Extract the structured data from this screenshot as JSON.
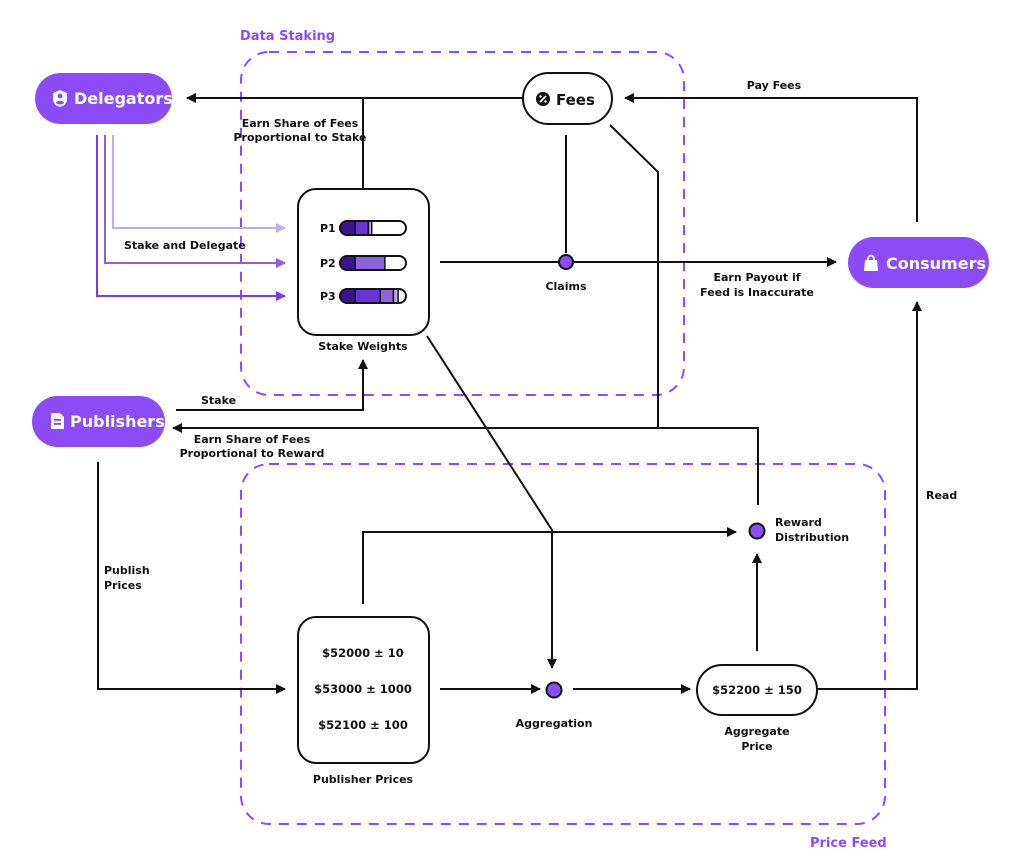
{
  "colors": {
    "accent": "#8b4cf7",
    "line": "#111111",
    "bar_dark": "#3b1491",
    "bar_mid": "#6a34d9",
    "bar_light": "#8d63e0",
    "bar_pale": "#c0a9f0",
    "delegate_pale": "#c2abf1",
    "delegate_mid": "#8b5ee6",
    "delegate_dark": "#7a3bf0"
  },
  "regions": {
    "data_staking": "Data Staking",
    "price_feed": "Price Feed"
  },
  "actors": {
    "delegators": {
      "label": "Delegators",
      "icon": "shield-user-icon"
    },
    "publishers": {
      "label": "Publishers",
      "icon": "document-icon"
    },
    "consumers": {
      "label": "Consumers",
      "icon": "shopping-bag-icon"
    }
  },
  "fees": {
    "label": "Fees",
    "icon": "percent-badge-icon"
  },
  "stake_weights": {
    "label": "Stake Weights",
    "publishers": [
      {
        "name": "P1",
        "segments": [
          {
            "share": 0.23,
            "color": "bar_dark"
          },
          {
            "share": 0.2,
            "color": "bar_mid"
          },
          {
            "share": 0.05,
            "color": "bar_pale"
          }
        ]
      },
      {
        "name": "P2",
        "segments": [
          {
            "share": 0.23,
            "color": "bar_dark"
          },
          {
            "share": 0.45,
            "color": "bar_light"
          }
        ]
      },
      {
        "name": "P3",
        "segments": [
          {
            "share": 0.23,
            "color": "bar_dark"
          },
          {
            "share": 0.38,
            "color": "bar_mid"
          },
          {
            "share": 0.2,
            "color": "bar_light"
          },
          {
            "share": 0.07,
            "color": "bar_pale"
          }
        ]
      }
    ]
  },
  "publisher_prices": {
    "label": "Publisher Prices",
    "values": [
      "$52000 ± 10",
      "$53000 ± 1000",
      "$52100 ± 100"
    ]
  },
  "aggregate_price": {
    "value": "$52200 ± 150",
    "label_line1": "Aggregate",
    "label_line2": "Price"
  },
  "nodes": {
    "claims": "Claims",
    "aggregation": "Aggregation",
    "reward_line1": "Reward",
    "reward_line2": "Distribution"
  },
  "edges": {
    "earn_stake_line1": "Earn Share of Fees",
    "earn_stake_line2": "Proportional to Stake",
    "pay_fees": "Pay Fees",
    "stake_and_delegate": "Stake and Delegate",
    "payout_line1": "Earn Payout if",
    "payout_line2": "Feed is Inaccurate",
    "stake": "Stake",
    "earn_reward_line1": "Earn Share of Fees",
    "earn_reward_line2": "Proportional to Reward",
    "publish_line1": "Publish",
    "publish_line2": "Prices",
    "read": "Read"
  }
}
